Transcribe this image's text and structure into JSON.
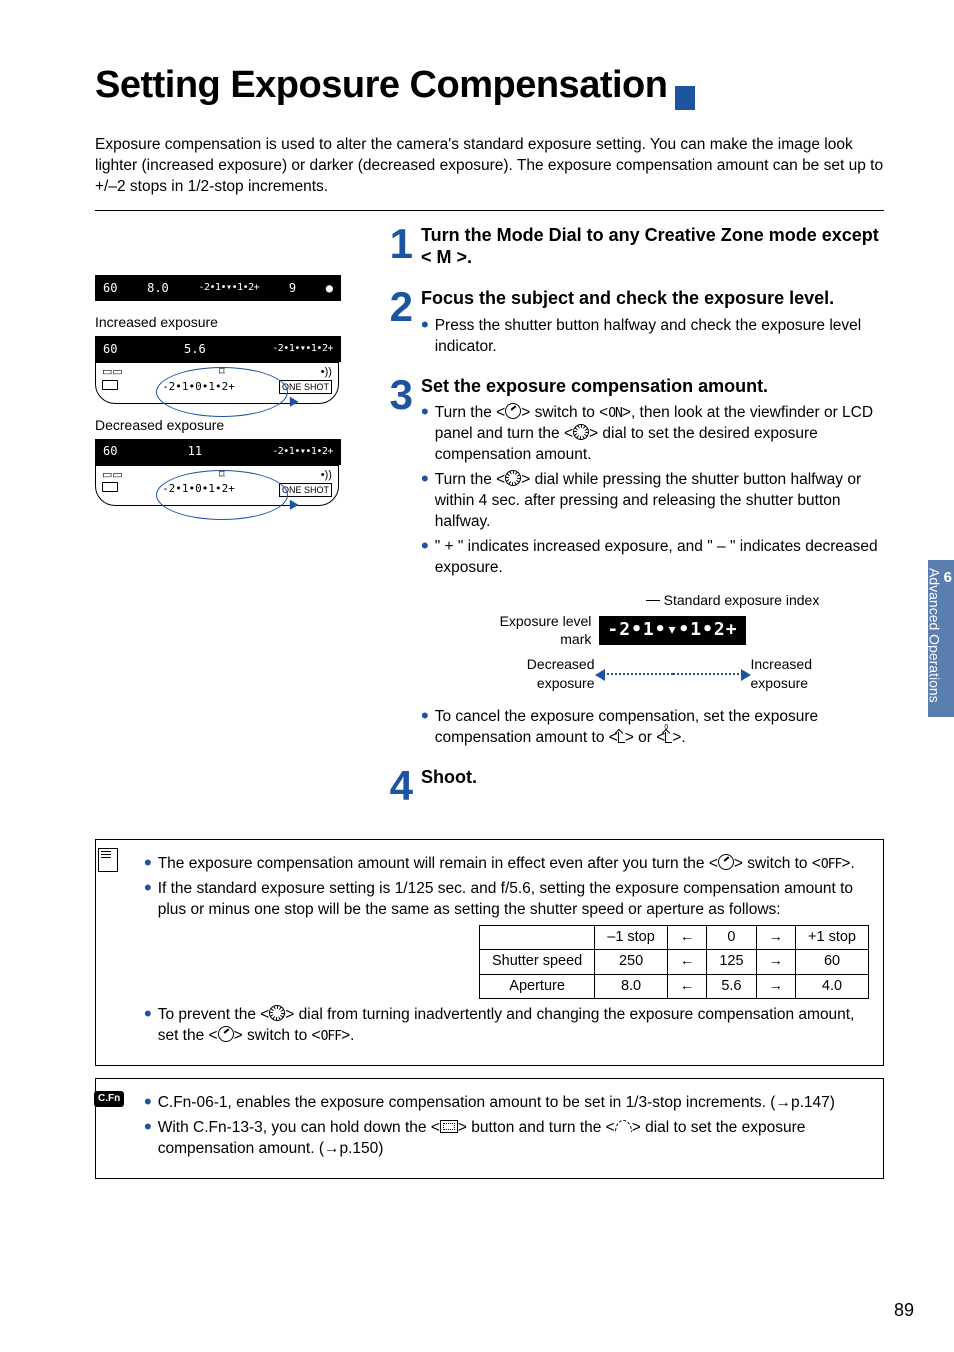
{
  "title": "Setting Exposure Compensation",
  "intro": "Exposure compensation is used to alter the camera's standard exposure setting. You can make the image look lighter (increased exposure) or darker (decreased exposure). The exposure compensation amount can be set up to +/–2 stops in 1/2-stop increments.",
  "vf_main": {
    "shutter": "60",
    "aperture": "8.0",
    "scale": "-2•1•▾•1•2+",
    "shots": "9"
  },
  "exp_increased": {
    "caption": "Increased exposure",
    "vf": {
      "shutter": "60",
      "aperture": "5.6",
      "scale": "-2•1•▾•1•2+"
    },
    "lcd_scale": "-2•1•0•1•2+",
    "oneshot": "ONE SHOT"
  },
  "exp_decreased": {
    "caption": "Decreased exposure",
    "vf": {
      "shutter": "60",
      "aperture": "11",
      "scale": "-2•1•▾•1•2+"
    },
    "lcd_scale": "-2•1•0•1•2+",
    "oneshot": "ONE SHOT"
  },
  "steps": {
    "s1": {
      "num": "1",
      "head": "Turn the Mode Dial to any Creative Zone mode except < M >."
    },
    "s2": {
      "num": "2",
      "head": "Focus the subject and check the exposure level.",
      "b1": "Press the shutter button halfway and check the exposure level indicator."
    },
    "s3": {
      "num": "3",
      "head": "Set the exposure compensation amount.",
      "b1_a": "Turn the <",
      "b1_b": "> switch to <",
      "b1_c": ">, then look at the viewfinder or LCD panel and turn the <",
      "b1_d": "> dial to set the desired exposure compensation amount.",
      "on_label": "ON",
      "b2_a": "Turn the <",
      "b2_b": "> dial while pressing the shutter button halfway or within 4 sec. after pressing and releasing the shutter button halfway.",
      "b3": "\" + \" indicates increased exposure, and \" – \" indicates decreased exposure.",
      "std_index": "Standard exposure index",
      "exp_level_mark": "Exposure level mark",
      "scale_box": "-2•1•▾•1•2+",
      "decreased": "Decreased exposure",
      "increased": "Increased exposure",
      "cancel_a": "To cancel the exposure compensation, set the exposure compensation amount to <",
      "cancel_b": "> or <",
      "cancel_c": ">."
    },
    "s4": {
      "num": "4",
      "head": "Shoot."
    }
  },
  "notes": {
    "n1_a": "The exposure compensation amount will remain in effect even after you turn the <",
    "n1_b": "> switch to <",
    "n1_c": ">.",
    "off_label": "OFF",
    "n2": "If the standard exposure setting is 1/125 sec. and f/5.6, setting the exposure compensation amount to plus or minus one stop will be the same as setting the shutter speed or aperture as follows:",
    "n3_a": "To prevent the <",
    "n3_b": "> dial from turning inadvertently and changing the exposure compensation amount, set the <",
    "n3_c": "> switch to <",
    "n3_d": ">."
  },
  "cfn": {
    "label": "C.Fn",
    "c1": "C.Fn-06-1, enables the exposure compensation amount to be set in 1/3-stop increments. (→p.147)",
    "c2_a": "With C.Fn-13-3, you can hold down the <",
    "c2_b": "> button and turn the <",
    "c2_c": "> dial to set the exposure compensation amount. (→p.150)"
  },
  "table": {
    "headers": [
      "",
      "–1 stop",
      "←",
      "0",
      "→",
      "+1 stop"
    ],
    "rows": [
      {
        "label": "Shutter speed",
        "cells": [
          "250",
          "←",
          "125",
          "→",
          "60"
        ]
      },
      {
        "label": "Aperture",
        "cells": [
          "8.0",
          "←",
          "5.6",
          "→",
          "4.0"
        ]
      }
    ]
  },
  "sidetab": {
    "num": "6",
    "label": "Advanced Operations"
  },
  "pagenum": "89"
}
